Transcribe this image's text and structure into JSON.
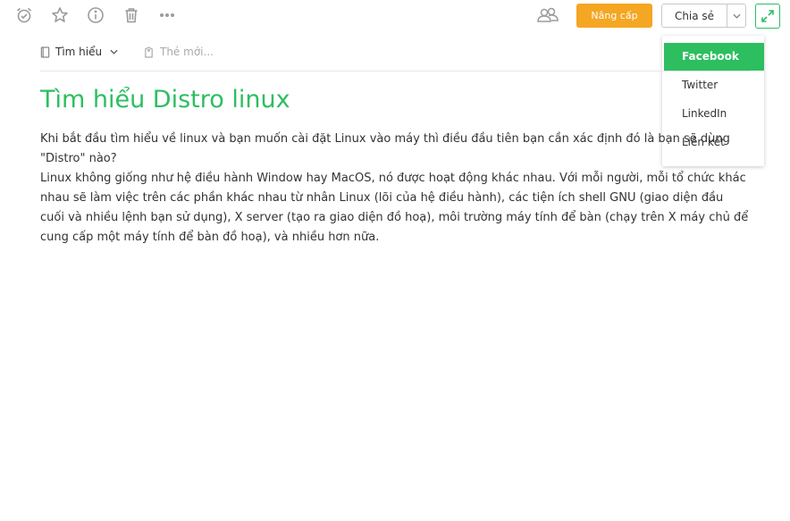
{
  "toolbar": {
    "icons": [
      "reminder-icon",
      "star-icon",
      "info-icon",
      "trash-icon",
      "more-icon",
      "work-chat-icon"
    ],
    "upgrade_label": "Nâng cấp",
    "share_label": "Chia sẻ",
    "expand_icon": "expand-icon"
  },
  "share_menu": {
    "items": [
      {
        "label": "Facebook",
        "active": true
      },
      {
        "label": "Twitter",
        "active": false
      },
      {
        "label": "LinkedIn",
        "active": false
      },
      {
        "label": "Liên kết",
        "active": false
      }
    ]
  },
  "note": {
    "notebook": "Tìm hiểu",
    "tag_placeholder": "Thẻ mới...",
    "title": "Tìm hiểu Distro linux",
    "paragraphs": [
      "Khi bắt đầu tìm hiểu về linux và bạn muốn cài đặt Linux vào máy thì điều đầu tiên bạn cần xác định đó là bạn sẽ dùng \"Distro\" nào?",
      "Linux không giống như hệ điều hành Window hay MacOS, nó được hoạt động khác nhau. Với mỗi người, mỗi tổ chức khác nhau sẽ làm việc trên các phần khác nhau từ nhân Linux (lõi của hệ điều hành), các tiện ích shell GNU (giao diện đầu cuối và nhiều lệnh bạn sử dụng), X server (tạo ra giao diện đồ hoạ), môi trường máy tính để bàn (chạy trên X máy chủ để cung cấp một máy tính để bàn đồ hoạ), và nhiều hơn nữa."
    ]
  },
  "colors": {
    "accent": "#2dbe60",
    "upgrade": "#f5a623",
    "icon": "#9b9b9b"
  }
}
